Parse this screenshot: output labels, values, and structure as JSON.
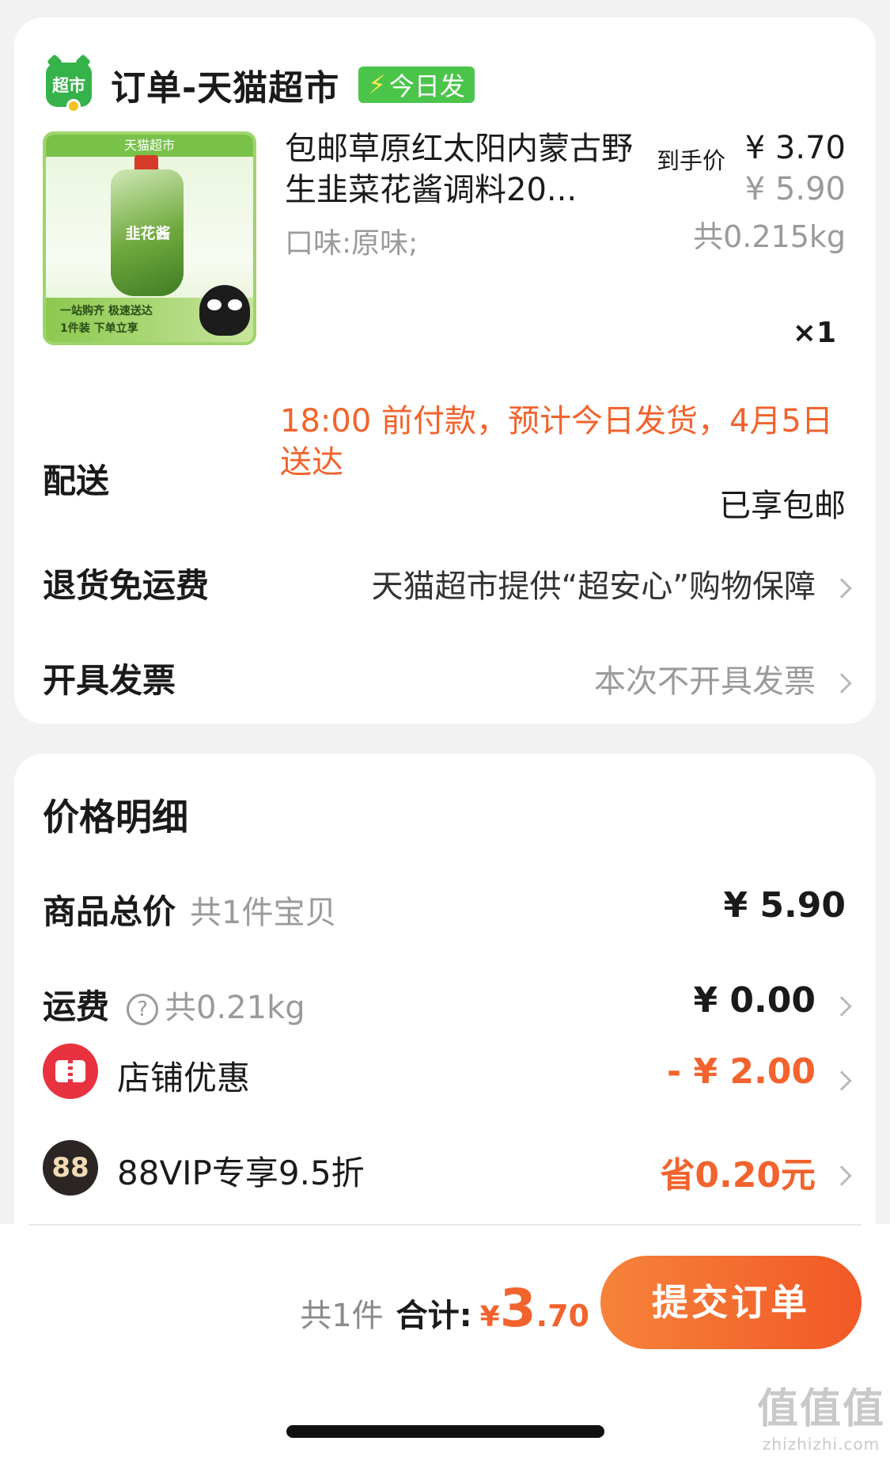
{
  "order": {
    "logo_text": "超市",
    "title": "订单-天猫超市",
    "badge": "今日发",
    "badge_icon": "lightning-icon",
    "product": {
      "image_banner": "天猫超市",
      "image_pouch_label": "韭花酱",
      "image_footer_1": "一站购齐 极速送达",
      "image_footer_2": "1件装 下单立享",
      "title": "包邮草原红太阳内蒙古野生韭菜花酱调料20...",
      "spec": "口味:原味;",
      "price_label": "到手价",
      "price": "¥ 3.70",
      "original_price": "¥ 5.90",
      "weight": "共0.215kg",
      "quantity": "×1"
    },
    "delivery": {
      "label": "配送",
      "text": "18:00 前付款，预计今日发货，4月5日送达",
      "free_shipping": "已享包邮"
    },
    "return_fee": {
      "label": "退货免运费",
      "value": "天猫超市提供“超安心”购物保障"
    },
    "invoice": {
      "label": "开具发票",
      "value": "本次不开具发票"
    }
  },
  "price_detail": {
    "title": "价格明细",
    "goods_total": {
      "label": "商品总价",
      "sub": "共1件宝贝",
      "amount": "¥ 5.90"
    },
    "shipping": {
      "label": "运费",
      "help": "?",
      "sub": "共0.21kg",
      "amount": "¥ 0.00"
    },
    "store_discount": {
      "label": "店铺优惠",
      "amount": "- ¥ 2.00"
    },
    "vip": {
      "icon_text": "88",
      "label": "88VIP专享9.5折",
      "amount": "省0.20元"
    }
  },
  "footer": {
    "count": "共1件",
    "total_label": "合计:",
    "yen": "¥",
    "total_int": "3",
    "total_dec": ".70",
    "submit": "提交订单"
  },
  "watermark": {
    "main": "值值值",
    "sub": "zhizhizhi.com"
  },
  "colors": {
    "accent": "#f2632d",
    "tmall_green": "#35b24a",
    "submit_gradient": [
      "#f6833a",
      "#f25826"
    ]
  }
}
